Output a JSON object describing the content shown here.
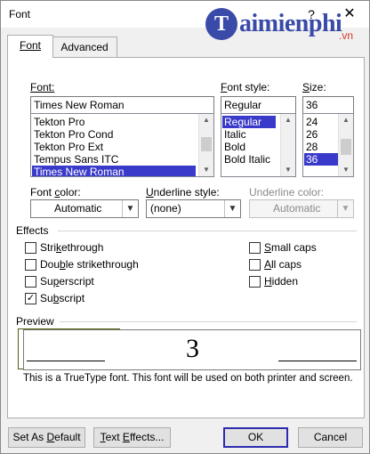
{
  "dialog": {
    "title": "Font",
    "help_glyph": "?",
    "close_glyph": "✕"
  },
  "watermark": {
    "mark": "T",
    "text": "aimienphi",
    "sub": ".vn"
  },
  "tabs": [
    {
      "label": "Font",
      "active": true
    },
    {
      "label": "Advanced",
      "active": false
    }
  ],
  "font": {
    "label": "Font:",
    "value": "Times New Roman",
    "items": [
      "Tekton Pro",
      "Tekton Pro Cond",
      "Tekton Pro Ext",
      "Tempus Sans ITC",
      "Times New Roman"
    ],
    "selected": "Times New Roman"
  },
  "font_style": {
    "label": "Font style:",
    "value": "Regular",
    "items": [
      "Regular",
      "Italic",
      "Bold",
      "Bold Italic"
    ],
    "selected": "Regular"
  },
  "size": {
    "label": "Size:",
    "value": "36",
    "items": [
      "24",
      "26",
      "28",
      "36"
    ],
    "selected": "36"
  },
  "font_color": {
    "label": "Font color:",
    "value": "Automatic"
  },
  "underline_style": {
    "label": "Underline style:",
    "value": "(none)"
  },
  "underline_color": {
    "label": "Underline color:",
    "value": "Automatic"
  },
  "effects": {
    "label": "Effects",
    "items": [
      {
        "id": "strikethrough",
        "label": "Strikethrough",
        "checked": false
      },
      {
        "id": "double-strikethrough",
        "label": "Double strikethrough",
        "checked": false
      },
      {
        "id": "superscript",
        "label": "Superscript",
        "checked": false
      },
      {
        "id": "subscript",
        "label": "Subscript",
        "checked": true
      },
      {
        "id": "small-caps",
        "label": "Small caps",
        "checked": false
      },
      {
        "id": "all-caps",
        "label": "All caps",
        "checked": false
      },
      {
        "id": "hidden",
        "label": "Hidden",
        "checked": false
      }
    ]
  },
  "preview": {
    "label": "Preview",
    "text": "3",
    "note": "This is a TrueType font. This font will be used on both printer and screen."
  },
  "buttons": {
    "set_default": "Set As Default",
    "text_effects": "Text Effects...",
    "ok": "OK",
    "cancel": "Cancel"
  },
  "colors": {
    "selection": "#3a3aca",
    "highlight_border": "#4b5e0a",
    "default_button_border": "#2b2bb0"
  }
}
